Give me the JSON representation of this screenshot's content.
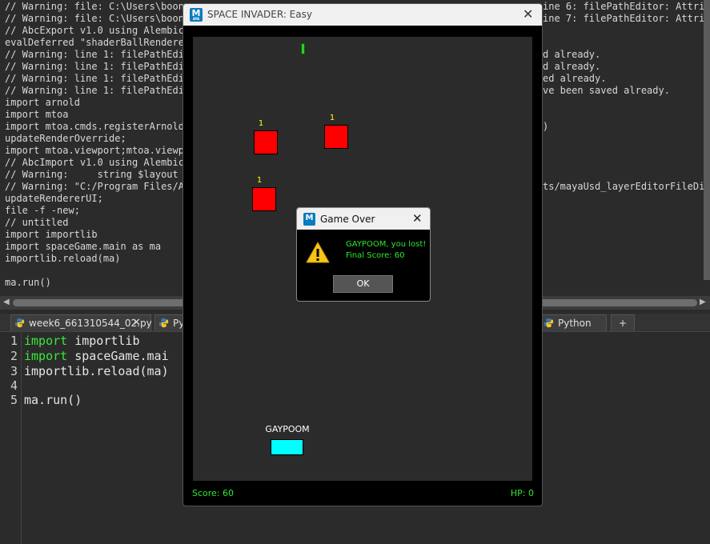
{
  "script_output": {
    "lines": [
      "// Warning: file: C:\\Users\\boony",
      "// Warning: file: C:\\Users\\boony",
      "// AbcExport v1.0 using Alembic",
      "evalDeferred \"shaderBallRenderer",
      "// Warning: line 1: filePathEdit",
      "// Warning: line 1: filePathEdit",
      "// Warning: line 1: filePathEdit",
      "// Warning: line 1: filePathEdit",
      "import arnold",
      "import mtoa",
      "import mtoa.cmds.registerArnoldR",
      "updateRenderOverride;",
      "import mtoa.viewport;mtoa.viewpo",
      "// AbcImport v1.0 using Alembic",
      "// Warning:     string $layout =",
      "// Warning: \"C:/Program Files/Au",
      "updateRendererUI;",
      "file -f -new;",
      "// untitled",
      "import importlib",
      "import spaceGame.main as ma",
      "importlib.reload(ma)",
      "",
      "ma.run()"
    ],
    "right_lines": [
      "ine 6: filePathEditor: Attribu",
      "ine 7: filePathEditor: Attribu",
      "",
      "",
      "d already.",
      "d already.",
      "ed already.",
      "ve been saved already.",
      "",
      "",
      ")",
      "",
      "",
      "",
      "",
      "ts/mayaUsd_layerEditorFileDial"
    ]
  },
  "tabs": [
    {
      "label": "week6_661310544_02.py"
    },
    {
      "label": "Py"
    },
    {
      "label": "Python"
    },
    {
      "label": "+"
    }
  ],
  "code": {
    "line_numbers": [
      "1",
      "2",
      "3",
      "4",
      "5"
    ],
    "lines": [
      {
        "kw": "import",
        "rest": " importlib"
      },
      {
        "kw": "import",
        "rest": " spaceGame.mai"
      },
      {
        "kw": "",
        "rest": "importlib.reload(ma)"
      },
      {
        "kw": "",
        "rest": ""
      },
      {
        "kw": "",
        "rest": "ma.run()"
      }
    ]
  },
  "game_window": {
    "title": "SPACE INVADER: Easy",
    "logo": "M",
    "logo_sub": "AYA",
    "close_icon": "✕"
  },
  "game": {
    "enemies": [
      {
        "hp": "1"
      },
      {
        "hp": "1"
      },
      {
        "hp": "1"
      }
    ],
    "player_name": "GAYPOOM",
    "score_text": "Score: 60",
    "hp_text": "HP: 0",
    "colors": {
      "enemy": "#ff0000",
      "player": "#00ffff",
      "bullet": "#2ecc2e",
      "hud": "#2ee82e"
    }
  },
  "dialog": {
    "title": "Game Over",
    "logo": "M",
    "close_icon": "✕",
    "message_line1": "GAYPOOM, you lost!",
    "message_line2": "Final Score: 60",
    "ok_label": "OK",
    "icon": "warning-icon"
  }
}
